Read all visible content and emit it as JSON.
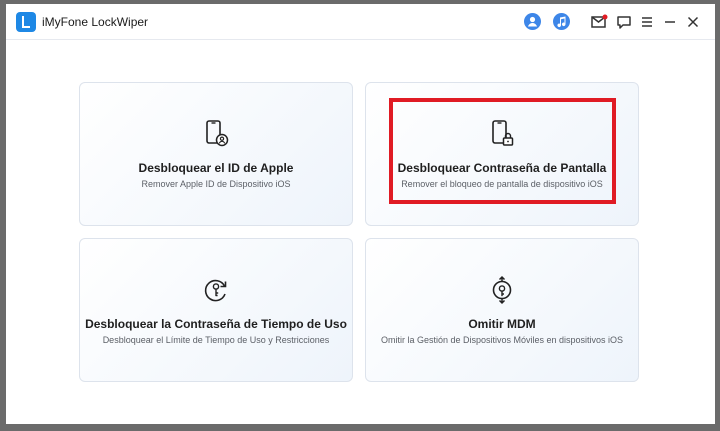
{
  "app": {
    "title": "iMyFone LockWiper"
  },
  "header": {
    "icons": [
      "user-icon",
      "music-icon",
      "mail-icon",
      "feedback-icon",
      "menu-icon",
      "minimize-icon",
      "close-icon"
    ]
  },
  "cards": [
    {
      "title": "Desbloquear el ID de Apple",
      "subtitle": "Remover Apple ID de Dispositivo iOS",
      "icon": "phone-user-icon"
    },
    {
      "title": "Desbloquear Contraseña de Pantalla",
      "subtitle": "Remover el bloqueo de pantalla de dispositivo iOS",
      "icon": "phone-lock-icon"
    },
    {
      "title": "Desbloquear la Contraseña de Tiempo de Uso",
      "subtitle": "Desbloquear el Límite de Tiempo de Uso y Restricciones",
      "icon": "clock-key-icon"
    },
    {
      "title": "Omitir MDM",
      "subtitle": "Omitir la Gestión de Dispositivos Móviles en dispositivos iOS",
      "icon": "mdm-icon"
    }
  ],
  "colors": {
    "accent": "#3d86e8",
    "highlight": "#e01b24",
    "card_border": "#dde3ec"
  }
}
